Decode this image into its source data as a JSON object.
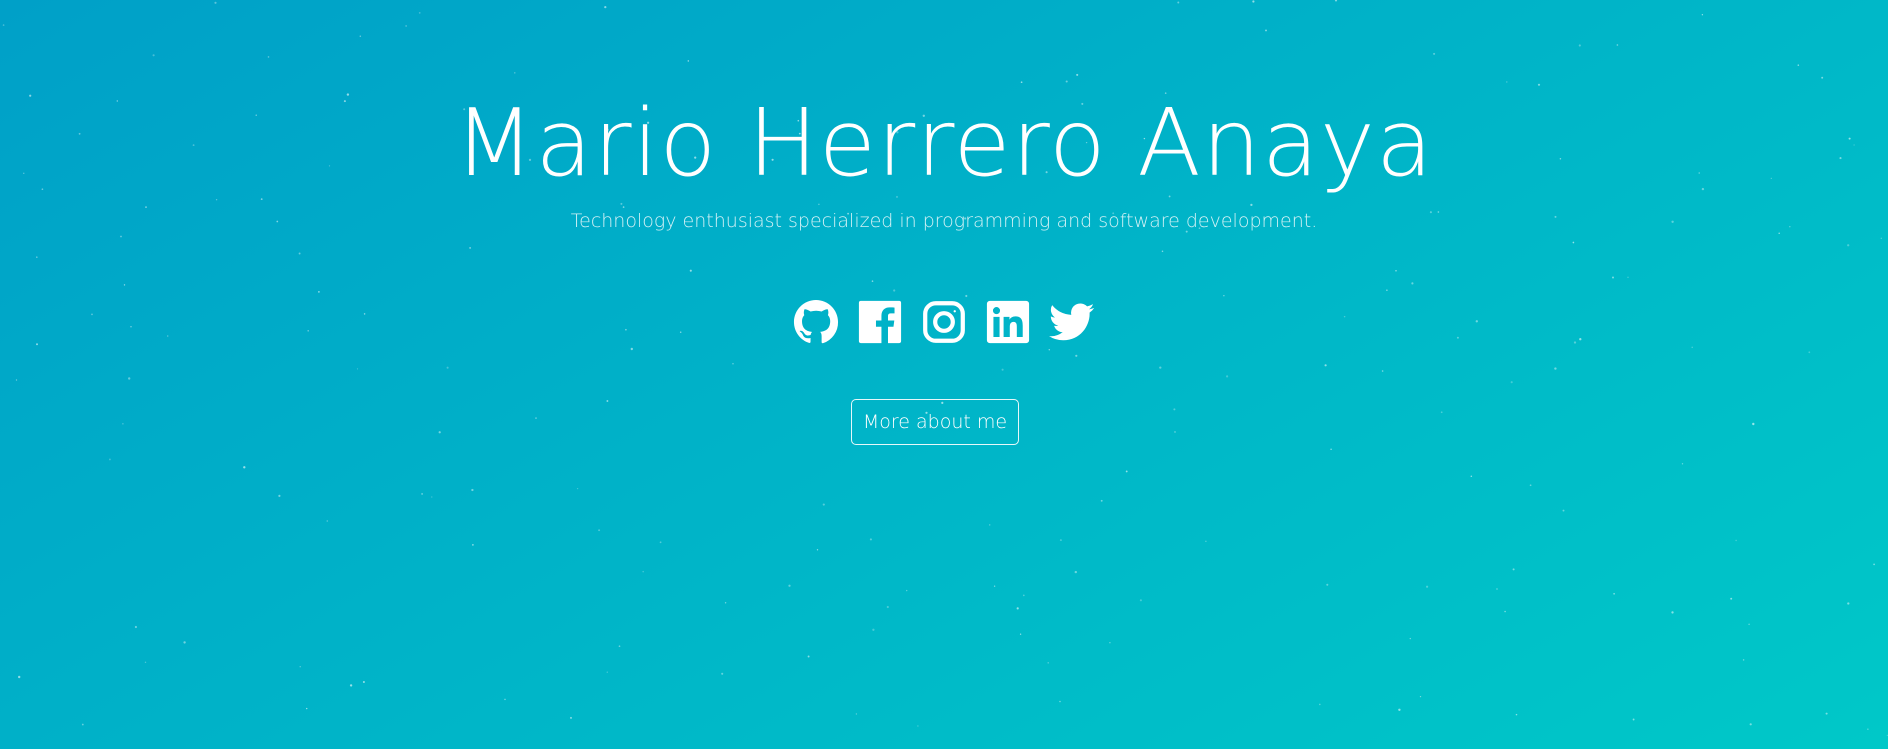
{
  "hero": {
    "title": "Mario Herrero Anaya",
    "subtitle": "Technology enthusiast specialized in programming and software development.",
    "more_button_label": "More about me"
  },
  "social": [
    {
      "name": "github",
      "icon": "github-icon"
    },
    {
      "name": "facebook",
      "icon": "facebook-icon"
    },
    {
      "name": "instagram",
      "icon": "instagram-icon"
    },
    {
      "name": "linkedin",
      "icon": "linkedin-icon"
    },
    {
      "name": "twitter",
      "icon": "twitter-icon"
    }
  ],
  "colors": {
    "gradient_start": "#00a0c8",
    "gradient_end": "#00c8c8",
    "text": "#ffffff"
  }
}
